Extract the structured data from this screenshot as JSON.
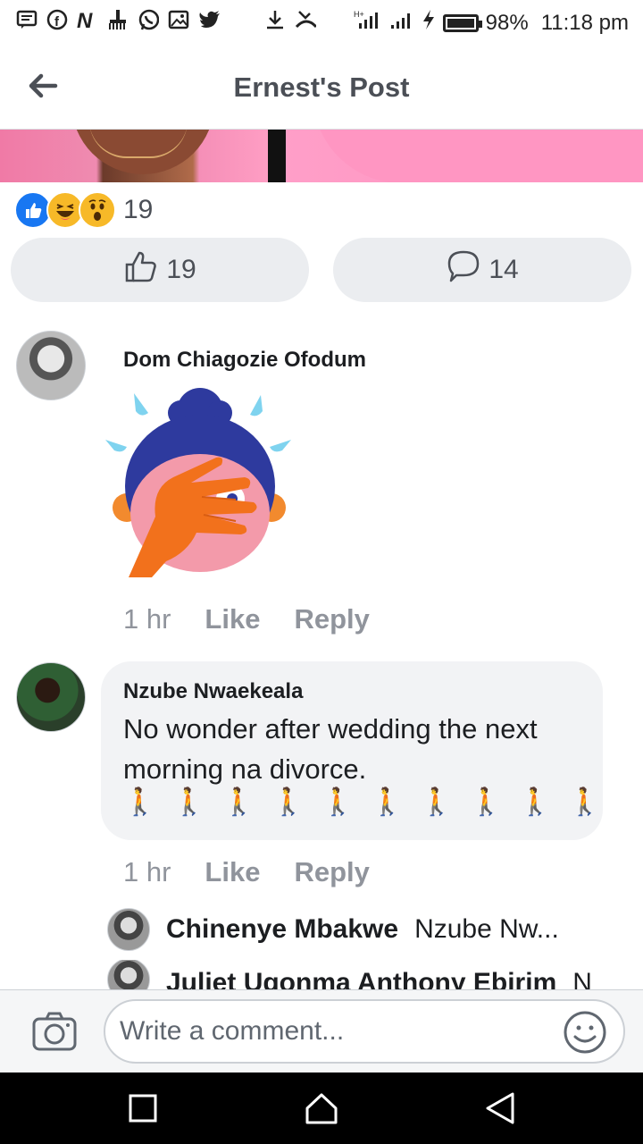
{
  "status_bar": {
    "battery": "98%",
    "time": "11:18 pm",
    "left_icons": [
      "message-icon",
      "facebook-icon",
      "n-app-icon",
      "broom-icon",
      "whatsapp-icon",
      "gallery-icon",
      "twitter-icon",
      "download-icon",
      "missed-call-icon"
    ],
    "right_icons": [
      "signal-icon",
      "signal-icon",
      "charging-icon",
      "battery-icon"
    ]
  },
  "header": {
    "title": "Ernest's Post"
  },
  "reactions": {
    "count": "19",
    "types": [
      "like",
      "haha",
      "wow"
    ]
  },
  "actions": {
    "likes": "19",
    "comments": "14"
  },
  "comments": [
    {
      "author": "Dom Chiagozie Ofodum",
      "sticker": "facepalm-sticker",
      "time": "1 hr",
      "like": "Like",
      "reply": "Reply"
    },
    {
      "author": "Nzube Nwaekeala",
      "text": "No wonder after wedding the next morning na divorce.",
      "emoji": [
        "🚶",
        "🚶",
        "🚶",
        "🚶",
        "🚶",
        "🚶",
        "🚶",
        "🚶",
        "🚶",
        "🚶"
      ],
      "time": "1 hr",
      "like": "Like",
      "reply": "Reply",
      "replies": [
        {
          "author": "Chinenye Mbakwe",
          "text": "Nzube Nw..."
        },
        {
          "author": "Juliet Ugonma Anthony Ebirim",
          "text": "N"
        }
      ]
    }
  ],
  "composer": {
    "placeholder": "Write a comment..."
  },
  "colors": {
    "accent": "#1877f2",
    "text": "#1c1e21",
    "muted": "#90949c",
    "bubble": "#f2f3f5"
  }
}
